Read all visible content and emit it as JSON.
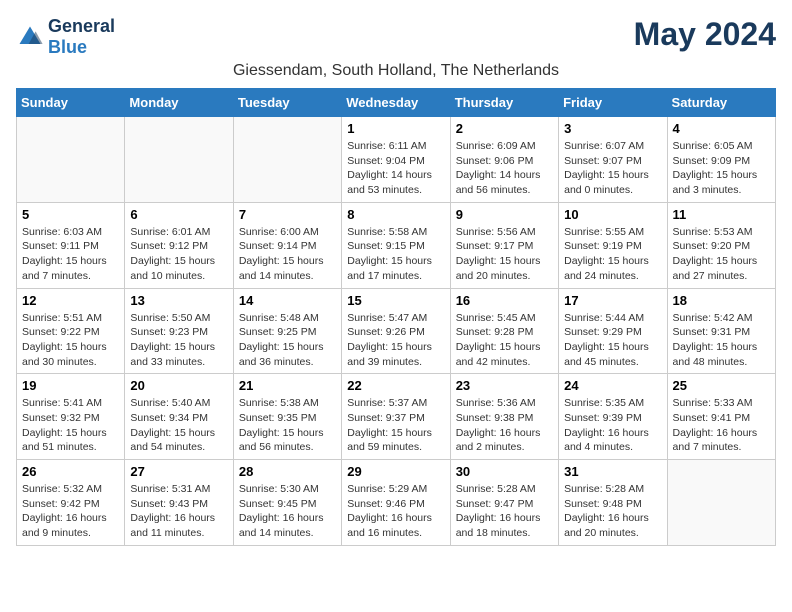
{
  "logo": {
    "general": "General",
    "blue": "Blue"
  },
  "title": "May 2024",
  "location": "Giessendam, South Holland, The Netherlands",
  "days_of_week": [
    "Sunday",
    "Monday",
    "Tuesday",
    "Wednesday",
    "Thursday",
    "Friday",
    "Saturday"
  ],
  "weeks": [
    [
      {
        "day": "",
        "info": ""
      },
      {
        "day": "",
        "info": ""
      },
      {
        "day": "",
        "info": ""
      },
      {
        "day": "1",
        "info": "Sunrise: 6:11 AM\nSunset: 9:04 PM\nDaylight: 14 hours and 53 minutes."
      },
      {
        "day": "2",
        "info": "Sunrise: 6:09 AM\nSunset: 9:06 PM\nDaylight: 14 hours and 56 minutes."
      },
      {
        "day": "3",
        "info": "Sunrise: 6:07 AM\nSunset: 9:07 PM\nDaylight: 15 hours and 0 minutes."
      },
      {
        "day": "4",
        "info": "Sunrise: 6:05 AM\nSunset: 9:09 PM\nDaylight: 15 hours and 3 minutes."
      }
    ],
    [
      {
        "day": "5",
        "info": "Sunrise: 6:03 AM\nSunset: 9:11 PM\nDaylight: 15 hours and 7 minutes."
      },
      {
        "day": "6",
        "info": "Sunrise: 6:01 AM\nSunset: 9:12 PM\nDaylight: 15 hours and 10 minutes."
      },
      {
        "day": "7",
        "info": "Sunrise: 6:00 AM\nSunset: 9:14 PM\nDaylight: 15 hours and 14 minutes."
      },
      {
        "day": "8",
        "info": "Sunrise: 5:58 AM\nSunset: 9:15 PM\nDaylight: 15 hours and 17 minutes."
      },
      {
        "day": "9",
        "info": "Sunrise: 5:56 AM\nSunset: 9:17 PM\nDaylight: 15 hours and 20 minutes."
      },
      {
        "day": "10",
        "info": "Sunrise: 5:55 AM\nSunset: 9:19 PM\nDaylight: 15 hours and 24 minutes."
      },
      {
        "day": "11",
        "info": "Sunrise: 5:53 AM\nSunset: 9:20 PM\nDaylight: 15 hours and 27 minutes."
      }
    ],
    [
      {
        "day": "12",
        "info": "Sunrise: 5:51 AM\nSunset: 9:22 PM\nDaylight: 15 hours and 30 minutes."
      },
      {
        "day": "13",
        "info": "Sunrise: 5:50 AM\nSunset: 9:23 PM\nDaylight: 15 hours and 33 minutes."
      },
      {
        "day": "14",
        "info": "Sunrise: 5:48 AM\nSunset: 9:25 PM\nDaylight: 15 hours and 36 minutes."
      },
      {
        "day": "15",
        "info": "Sunrise: 5:47 AM\nSunset: 9:26 PM\nDaylight: 15 hours and 39 minutes."
      },
      {
        "day": "16",
        "info": "Sunrise: 5:45 AM\nSunset: 9:28 PM\nDaylight: 15 hours and 42 minutes."
      },
      {
        "day": "17",
        "info": "Sunrise: 5:44 AM\nSunset: 9:29 PM\nDaylight: 15 hours and 45 minutes."
      },
      {
        "day": "18",
        "info": "Sunrise: 5:42 AM\nSunset: 9:31 PM\nDaylight: 15 hours and 48 minutes."
      }
    ],
    [
      {
        "day": "19",
        "info": "Sunrise: 5:41 AM\nSunset: 9:32 PM\nDaylight: 15 hours and 51 minutes."
      },
      {
        "day": "20",
        "info": "Sunrise: 5:40 AM\nSunset: 9:34 PM\nDaylight: 15 hours and 54 minutes."
      },
      {
        "day": "21",
        "info": "Sunrise: 5:38 AM\nSunset: 9:35 PM\nDaylight: 15 hours and 56 minutes."
      },
      {
        "day": "22",
        "info": "Sunrise: 5:37 AM\nSunset: 9:37 PM\nDaylight: 15 hours and 59 minutes."
      },
      {
        "day": "23",
        "info": "Sunrise: 5:36 AM\nSunset: 9:38 PM\nDaylight: 16 hours and 2 minutes."
      },
      {
        "day": "24",
        "info": "Sunrise: 5:35 AM\nSunset: 9:39 PM\nDaylight: 16 hours and 4 minutes."
      },
      {
        "day": "25",
        "info": "Sunrise: 5:33 AM\nSunset: 9:41 PM\nDaylight: 16 hours and 7 minutes."
      }
    ],
    [
      {
        "day": "26",
        "info": "Sunrise: 5:32 AM\nSunset: 9:42 PM\nDaylight: 16 hours and 9 minutes."
      },
      {
        "day": "27",
        "info": "Sunrise: 5:31 AM\nSunset: 9:43 PM\nDaylight: 16 hours and 11 minutes."
      },
      {
        "day": "28",
        "info": "Sunrise: 5:30 AM\nSunset: 9:45 PM\nDaylight: 16 hours and 14 minutes."
      },
      {
        "day": "29",
        "info": "Sunrise: 5:29 AM\nSunset: 9:46 PM\nDaylight: 16 hours and 16 minutes."
      },
      {
        "day": "30",
        "info": "Sunrise: 5:28 AM\nSunset: 9:47 PM\nDaylight: 16 hours and 18 minutes."
      },
      {
        "day": "31",
        "info": "Sunrise: 5:28 AM\nSunset: 9:48 PM\nDaylight: 16 hours and 20 minutes."
      },
      {
        "day": "",
        "info": ""
      }
    ]
  ]
}
